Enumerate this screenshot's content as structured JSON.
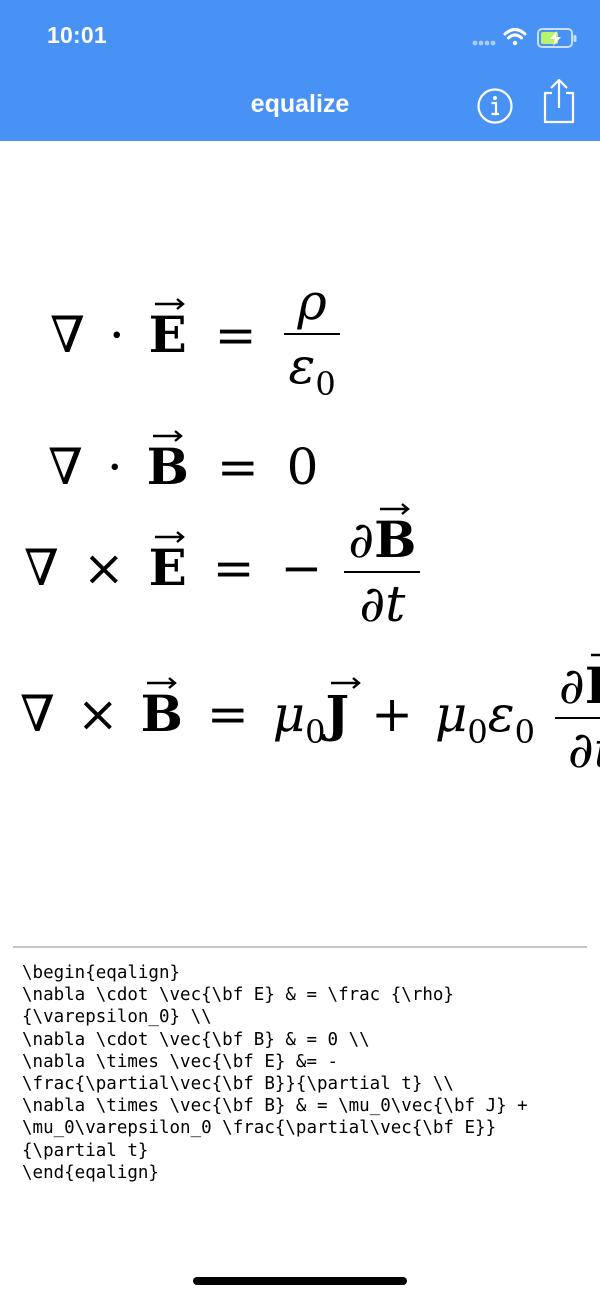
{
  "status_bar": {
    "time": "10:01"
  },
  "nav_bar": {
    "title": "equalize",
    "info_icon": "info-circle-icon",
    "share_icon": "share-icon"
  },
  "colors": {
    "nav_background": "#4892f6",
    "text": "#000000",
    "divider": "#c8c8c8"
  },
  "equations": [
    {
      "lhs": [
        "∇",
        "·",
        "E"
      ],
      "rel": "=",
      "rhs": {
        "numerator": "ρ",
        "denominator": "ε",
        "denominator_sub": "0"
      }
    },
    {
      "lhs": [
        "∇",
        "·",
        "B"
      ],
      "rel": "=",
      "rhs": "0"
    },
    {
      "lhs": [
        "∇",
        "×",
        "E"
      ],
      "rel": "=",
      "rhs": {
        "sign": "−",
        "numerator": "∂B",
        "denominator": "∂t"
      }
    },
    {
      "lhs": [
        "∇",
        "×",
        "B"
      ],
      "rel": "=",
      "rhs": {
        "term1": "μ",
        "term1_sub": "0",
        "term1_vec": "J",
        "plus": "+",
        "term2": "μ",
        "term2_sub": "0",
        "term2_eps": "ε",
        "term2_eps_sub": "0",
        "numerator": "∂E",
        "denominator": "∂t"
      }
    }
  ],
  "source_text": "\\begin{eqalign}\n\\nabla \\cdot \\vec{\\bf E} & = \\frac {\\rho}\n{\\varepsilon_0} \\\\\n\\nabla \\cdot \\vec{\\bf B} & = 0 \\\\\n\\nabla \\times \\vec{\\bf E} &= -\n\\frac{\\partial\\vec{\\bf B}}{\\partial t} \\\\\n\\nabla \\times \\vec{\\bf B} & = \\mu_0\\vec{\\bf J} +\n\\mu_0\\varepsilon_0 \\frac{\\partial\\vec{\\bf E}}\n{\\partial t}\n\\end{eqalign}"
}
